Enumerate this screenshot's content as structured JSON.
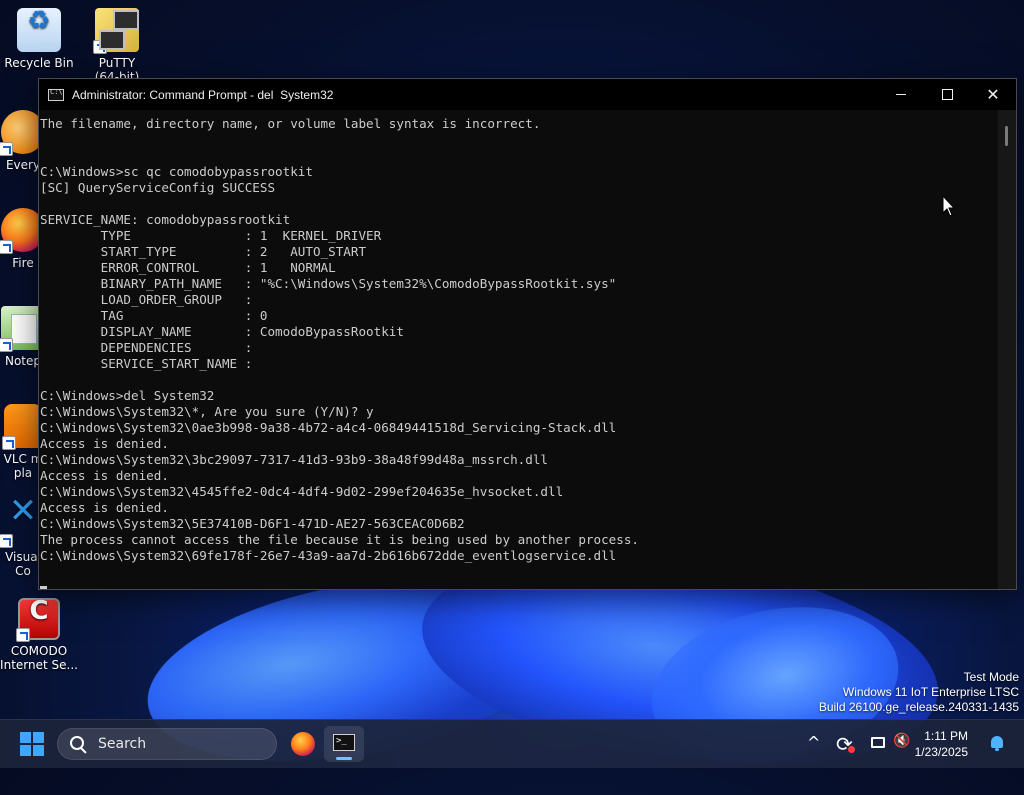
{
  "desktop": {
    "icons": [
      {
        "label": "Recycle Bin",
        "icon": "recycle-bin-icon"
      },
      {
        "label": "PuTTY\n(64-bit)",
        "icon": "putty-icon"
      },
      {
        "label": "Every",
        "icon": "everything-icon"
      },
      {
        "label": "Fire",
        "icon": "firefox-icon"
      },
      {
        "label": "Notep",
        "icon": "notepad-icon"
      },
      {
        "label": "VLC m\npla",
        "icon": "vlc-icon"
      },
      {
        "label": "Visual\nCo",
        "icon": "vscode-icon"
      },
      {
        "label": "COMODO\nInternet Se...",
        "icon": "comodo-icon"
      }
    ]
  },
  "window": {
    "title": "Administrator: Command Prompt - del  System32",
    "controls": {
      "minimize": "—",
      "maximize": "☐",
      "close": "✕"
    }
  },
  "console": {
    "lines": [
      "The filename, directory name, or volume label syntax is incorrect.",
      "",
      "",
      "C:\\Windows>sc qc comodobypassrootkit",
      "[SC] QueryServiceConfig SUCCESS",
      "",
      "SERVICE_NAME: comodobypassrootkit",
      "        TYPE               : 1  KERNEL_DRIVER",
      "        START_TYPE         : 2   AUTO_START",
      "        ERROR_CONTROL      : 1   NORMAL",
      "        BINARY_PATH_NAME   : \"%C:\\Windows\\System32%\\ComodoBypassRootkit.sys\"",
      "        LOAD_ORDER_GROUP   :",
      "        TAG                : 0",
      "        DISPLAY_NAME       : ComodoBypassRootkit",
      "        DEPENDENCIES       :",
      "        SERVICE_START_NAME :",
      "",
      "C:\\Windows>del System32",
      "C:\\Windows\\System32\\*, Are you sure (Y/N)? y",
      "C:\\Windows\\System32\\0ae3b998-9a38-4b72-a4c4-06849441518d_Servicing-Stack.dll",
      "Access is denied.",
      "C:\\Windows\\System32\\3bc29097-7317-41d3-93b9-38a48f99d48a_mssrch.dll",
      "Access is denied.",
      "C:\\Windows\\System32\\4545ffe2-0dc4-4df4-9d02-299ef204635e_hvsocket.dll",
      "Access is denied.",
      "C:\\Windows\\System32\\5E37410B-D6F1-471D-AE27-563CEAC0D6B2",
      "The process cannot access the file because it is being used by another process.",
      "C:\\Windows\\System32\\69fe178f-26e7-43a9-aa7d-2b616b672dde_eventlogservice.dll"
    ]
  },
  "watermark": {
    "line1": "Test Mode",
    "line2": "Windows 11 IoT Enterprise LTSC",
    "line3": "Build 26100.ge_release.240331-1435"
  },
  "taskbar": {
    "search_placeholder": "Search",
    "time": "1:11 PM",
    "date": "1/23/2025"
  },
  "colors": {
    "console_bg": "#0c0c0c",
    "console_text": "#cccccc",
    "accent": "#3ea6ff"
  }
}
